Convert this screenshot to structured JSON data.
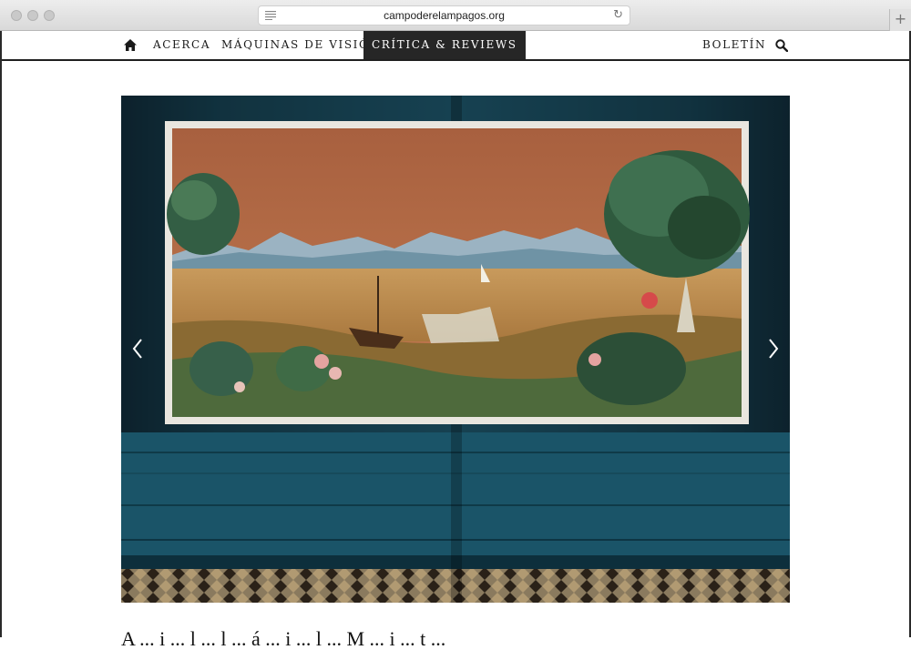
{
  "browser": {
    "url": "campoderelampagos.org",
    "new_tab_symbol": "+",
    "reload_symbol": "↻"
  },
  "nav": {
    "items": [
      {
        "label": "Acerca"
      },
      {
        "label": "Máquinas de visión"
      },
      {
        "label": "Crítica & Reviews",
        "active": true
      }
    ],
    "newsletter": "Boletín",
    "home_icon": "home-icon",
    "search_icon": "search-icon"
  },
  "slider": {
    "prev_icon": "chevron-left-icon",
    "next_icon": "chevron-right-icon"
  },
  "article": {
    "partial_text": "A ... i ... l ... l ... á ... i ... l ... M ... i ... t ..."
  },
  "colors": {
    "nav_active_bg": "#262626",
    "wall_teal": "#1f5a6e",
    "mural_sky": "#b8704a"
  }
}
